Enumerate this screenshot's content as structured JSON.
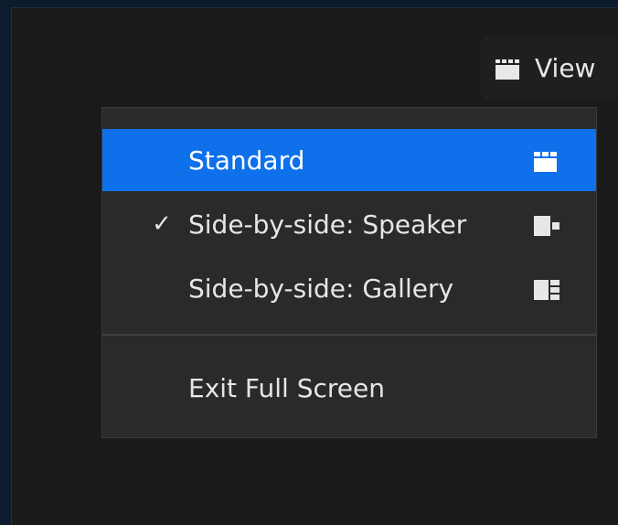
{
  "toolbar": {
    "view_label": "View",
    "view_icon": "gallery-grid-icon"
  },
  "menu": {
    "items": [
      {
        "label": "Standard",
        "selected": true,
        "checked": false,
        "icon": "gallery-grid-icon"
      },
      {
        "label": "Side-by-side: Speaker",
        "selected": false,
        "checked": true,
        "icon": "speaker-layout-icon"
      },
      {
        "label": "Side-by-side: Gallery",
        "selected": false,
        "checked": false,
        "icon": "gallery-layout-icon"
      }
    ],
    "exit_label": "Exit Full Screen",
    "check_glyph": "✓"
  },
  "colors": {
    "highlight": "#0e71eb",
    "menu_bg": "#2a2a2a",
    "text": "#e6e6e6"
  }
}
